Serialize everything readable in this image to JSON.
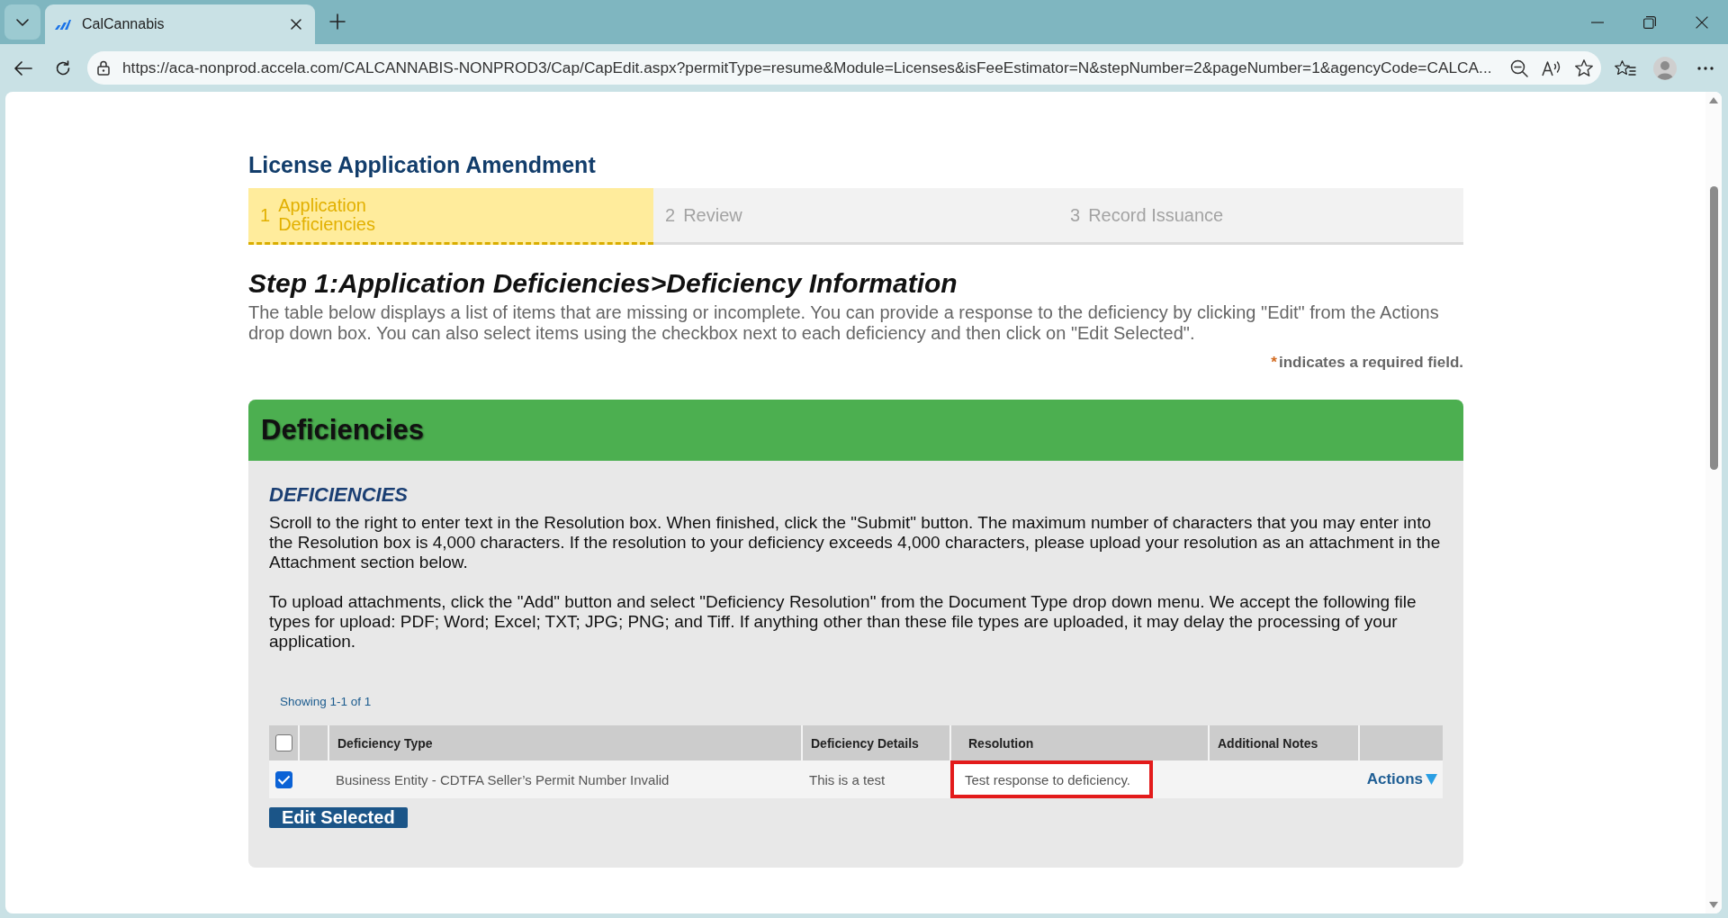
{
  "browser": {
    "tab_title": "CalCannabis",
    "address": "https://aca-nonprod.accela.com/CALCANNABIS-NONPROD3/Cap/CapEdit.aspx?permitType=resume&Module=Licenses&isFeeEstimator=N&stepNumber=2&pageNumber=1&agencyCode=CALCA..."
  },
  "page": {
    "title": "License Application Amendment",
    "steps": [
      {
        "number": "1",
        "label": "Application Deficiencies",
        "selected": true
      },
      {
        "number": "2",
        "label": "Review",
        "selected": false
      },
      {
        "number": "3",
        "label": "Record Issuance",
        "selected": false
      }
    ],
    "heading": "Step 1:Application Deficiencies>Deficiency Information",
    "intro": "The table below displays a list of items that are missing or incomplete. You can provide a response to the deficiency by clicking \"Edit\" from the Actions drop down box. You can also select items using the checkbox next to each deficiency and then click on \"Edit Selected\".",
    "required_note": {
      "marker": "*",
      "text": "indicates a required field."
    },
    "panel": {
      "title": "Deficiencies",
      "subtitle": "DEFICIENCIES",
      "paragraphs": [
        "Scroll to the right to enter text in the Resolution box. When finished, click the \"Submit\" button. The maximum number of characters that you may enter into the Resolution box is 4,000 characters. If the resolution to your deficiency exceeds 4,000 characters, please upload your resolution as an attachment in the Attachment section below.",
        "To upload attachments, click the \"Add\" button and select \"Deficiency Resolution\" from the Document Type drop down menu. We accept the following file types for upload: PDF; Word; Excel; TXT; JPG; PNG; and Tiff. If anything other than these file types are uploaded, it may delay the processing of your application."
      ],
      "pagination": "Showing 1-1 of 1",
      "table": {
        "select_all_checked": false,
        "columns": [
          "Deficiency Type",
          "Deficiency Details",
          "Resolution",
          "Additional Notes"
        ],
        "rows": [
          {
            "checked": true,
            "deficiency_type": "Business Entity - CDTFA Seller’s Permit Number Invalid",
            "deficiency_details": "This is a test",
            "resolution": {
              "value": "Test response to deficiency.",
              "highlighted": true
            },
            "action": "Actions"
          }
        ]
      },
      "button": "Edit Selected"
    }
  }
}
